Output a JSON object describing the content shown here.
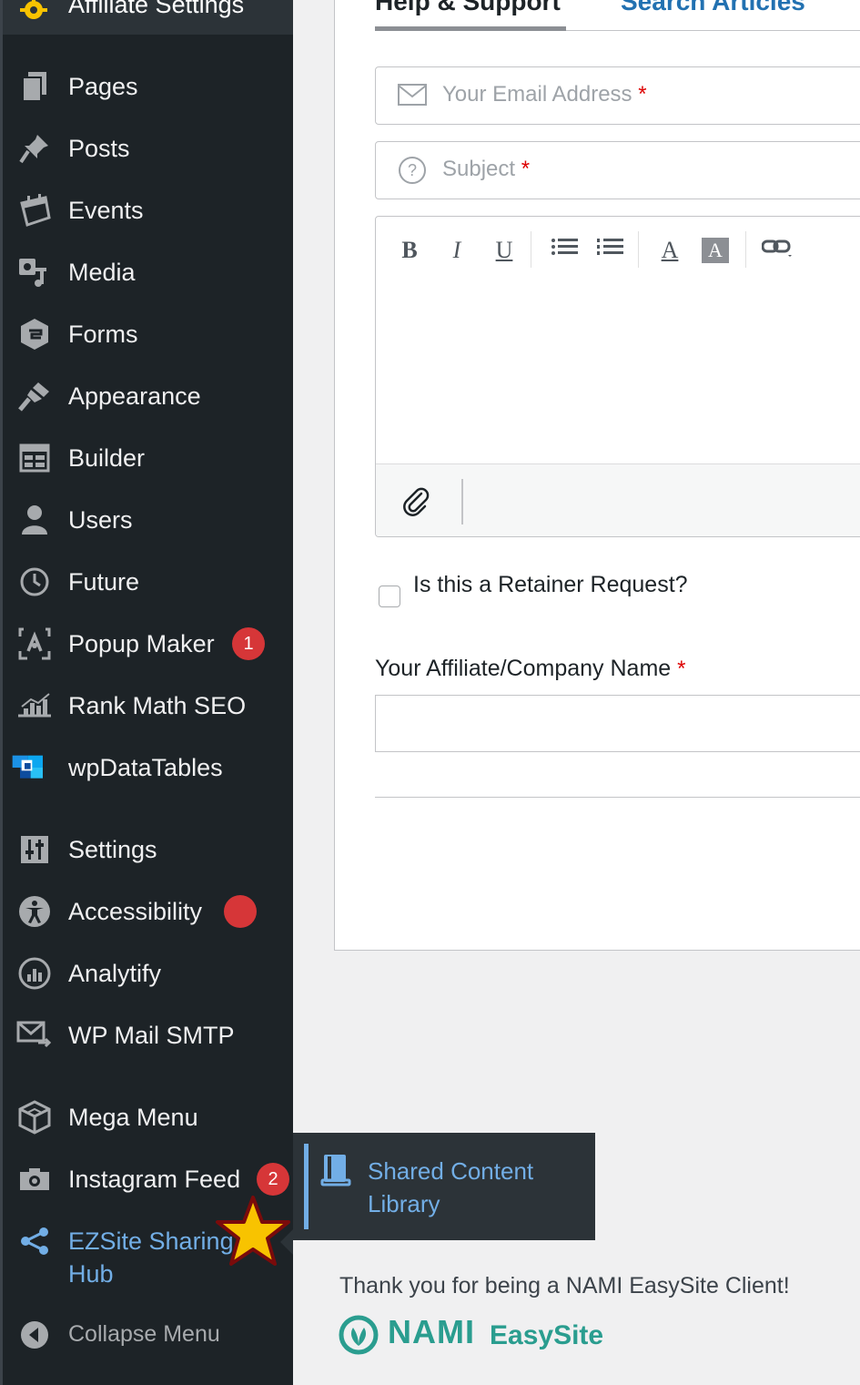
{
  "sidebar": {
    "top_item": {
      "label": "Affiliate Settings"
    },
    "items": [
      {
        "label": "Pages",
        "icon": "pages-icon"
      },
      {
        "label": "Posts",
        "icon": "pin-icon"
      },
      {
        "label": "Events",
        "icon": "calendar-icon"
      },
      {
        "label": "Media",
        "icon": "media-icon"
      },
      {
        "label": "Forms",
        "icon": "forms-icon"
      },
      {
        "label": "Appearance",
        "icon": "paintbrush-icon"
      },
      {
        "label": "Builder",
        "icon": "grid-icon"
      },
      {
        "label": "Users",
        "icon": "user-icon"
      },
      {
        "label": "Future",
        "icon": "clock-icon"
      },
      {
        "label": "Popup Maker",
        "icon": "popup-icon",
        "badge": "1"
      },
      {
        "label": "Rank Math SEO",
        "icon": "chart-icon"
      },
      {
        "label": "wpDataTables",
        "icon": "wpdatatables-icon"
      },
      {
        "label": "Settings",
        "icon": "settings-icon"
      },
      {
        "label": "Accessibility",
        "icon": "accessibility-icon"
      },
      {
        "label": "Analytify",
        "icon": "analytics-icon"
      },
      {
        "label": "WP Mail SMTP",
        "icon": "mail-icon"
      },
      {
        "label": "Mega Menu",
        "icon": "cube-icon"
      },
      {
        "label": "Instagram Feed",
        "icon": "camera-icon",
        "badge": "2"
      },
      {
        "label": "EZSite Sharing Hub",
        "icon": "share-icon"
      },
      {
        "label": "Collapse Menu",
        "icon": "collapse-icon"
      }
    ],
    "flyout": {
      "label": "Shared Content Library"
    }
  },
  "tabs": [
    {
      "label": "Help & Support"
    },
    {
      "label": "Search Articles"
    }
  ],
  "form": {
    "email_placeholder": "Your Email Address",
    "subject_placeholder": "Subject",
    "required_mark": "*",
    "toolbar": {
      "bold": "B",
      "italic": "I",
      "underline": "U",
      "font_color": "A",
      "bg_color": "A"
    },
    "retainer_label": "Is this a Retainer Request?",
    "company_label": "Your Affiliate/Company Name"
  },
  "footer": {
    "thanks": "Thank you for being a NAMI EasySite Client!",
    "logo_nami": "NAMI",
    "logo_easysite": "EasySite"
  },
  "colors": {
    "sidebar_bg": "#1d2327",
    "accent": "#72aee6",
    "badge": "#d63638",
    "star": "#f8c300"
  }
}
